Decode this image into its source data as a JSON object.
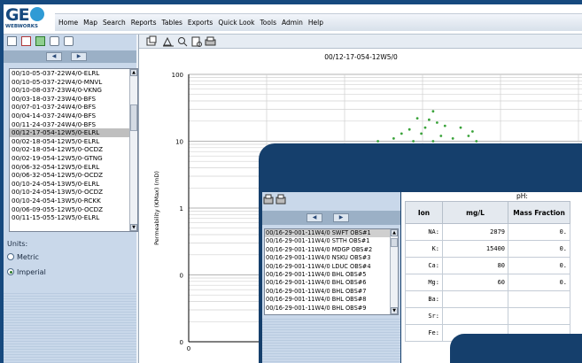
{
  "app": {
    "logo_text": "GE",
    "logo_sub": "WEBWORKS"
  },
  "menu": [
    "Home",
    "Map",
    "Search",
    "Reports",
    "Tables",
    "Exports",
    "Quick Look",
    "Tools",
    "Admin",
    "Help"
  ],
  "well_list": {
    "items": [
      "00/10-05-037-22W4/0-ELRL",
      "00/10-05-037-22W4/0-MNVL",
      "00/10-08-037-23W4/0-VKNG",
      "00/03-18-037-23W4/0-BFS",
      "00/07-01-037-24W4/0-BFS",
      "00/04-14-037-24W4/0-BFS",
      "00/11-24-037-24W4/0-BFS",
      "00/12-17-054-12W5/0-ELRL",
      "00/02-18-054-12W5/0-ELRL",
      "00/02-18-054-12W5/0-OCDZ",
      "00/02-19-054-12W5/0-GTNG",
      "00/06-32-054-12W5/0-ELRL",
      "00/06-32-054-12W5/0-OCDZ",
      "00/10-24-054-13W5/0-ELRL",
      "00/10-24-054-13W5/0-OCDZ",
      "00/10-24-054-13W5/0-RCKK",
      "00/06-09-055-12W5/0-OCDZ",
      "00/11-15-055-12W5/0-ELRL"
    ],
    "selected_index": 7
  },
  "units": {
    "label": "Units:",
    "options": [
      "Metric",
      "Imperial"
    ],
    "selected": "Imperial"
  },
  "chart_data": {
    "type": "scatter",
    "title": "00/12-17-054-12W5/0",
    "ylabel": "Permeability (KMax) (mD)",
    "yscale": "log",
    "ylim": [
      0.1,
      100
    ],
    "ytick_labels": [
      "100",
      "10",
      "1",
      "0",
      "0"
    ],
    "xtick_labels": [
      "0"
    ],
    "series": [
      {
        "color": "#3aa33a",
        "points": [
          {
            "x": 0.62,
            "y": 28
          },
          {
            "x": 0.58,
            "y": 22
          },
          {
            "x": 0.61,
            "y": 21
          },
          {
            "x": 0.63,
            "y": 19
          },
          {
            "x": 0.65,
            "y": 17
          },
          {
            "x": 0.6,
            "y": 16
          },
          {
            "x": 0.56,
            "y": 15
          },
          {
            "x": 0.69,
            "y": 16
          },
          {
            "x": 0.54,
            "y": 13
          },
          {
            "x": 0.59,
            "y": 13
          },
          {
            "x": 0.64,
            "y": 12
          },
          {
            "x": 0.67,
            "y": 11
          },
          {
            "x": 0.71,
            "y": 12
          },
          {
            "x": 0.72,
            "y": 14
          },
          {
            "x": 0.52,
            "y": 11
          },
          {
            "x": 0.57,
            "y": 10
          },
          {
            "x": 0.62,
            "y": 10
          },
          {
            "x": 0.48,
            "y": 10
          },
          {
            "x": 0.73,
            "y": 10
          }
        ]
      }
    ]
  },
  "overlay": {
    "well_list": [
      "00/16-29-001-11W4/0 SWFT OBS#1",
      "00/16-29-001-11W4/0 STTH OBS#1",
      "00/16-29-001-11W4/0 MDGP OBS#2",
      "00/16-29-001-11W4/0 NSKU OBS#3",
      "00/16-29-001-11W4/0 LDUC OBS#4",
      "00/16-29-001-11W4/0 BHL OBS#5",
      "00/16-29-001-11W4/0 BHL OBS#6",
      "00/16-29-001-11W4/0 BHL OBS#7",
      "00/16-29-001-11W4/0 BHL OBS#8",
      "00/16-29-001-11W4/0 BHL OBS#9"
    ],
    "ph_label": "pH:",
    "table": {
      "headers": [
        "Ion",
        "mg/L",
        "Mass Fraction"
      ],
      "rows": [
        {
          "ion": "NA:",
          "mgL": "2879",
          "frac": "0."
        },
        {
          "ion": "K:",
          "mgL": "15400",
          "frac": "0."
        },
        {
          "ion": "Ca:",
          "mgL": "80",
          "frac": "0."
        },
        {
          "ion": "Mg:",
          "mgL": "60",
          "frac": "0."
        },
        {
          "ion": "Ba:",
          "mgL": "",
          "frac": ""
        },
        {
          "ion": "Sr:",
          "mgL": "",
          "frac": ""
        },
        {
          "ion": "Fe:",
          "mgL": "",
          "frac": ""
        }
      ]
    }
  }
}
